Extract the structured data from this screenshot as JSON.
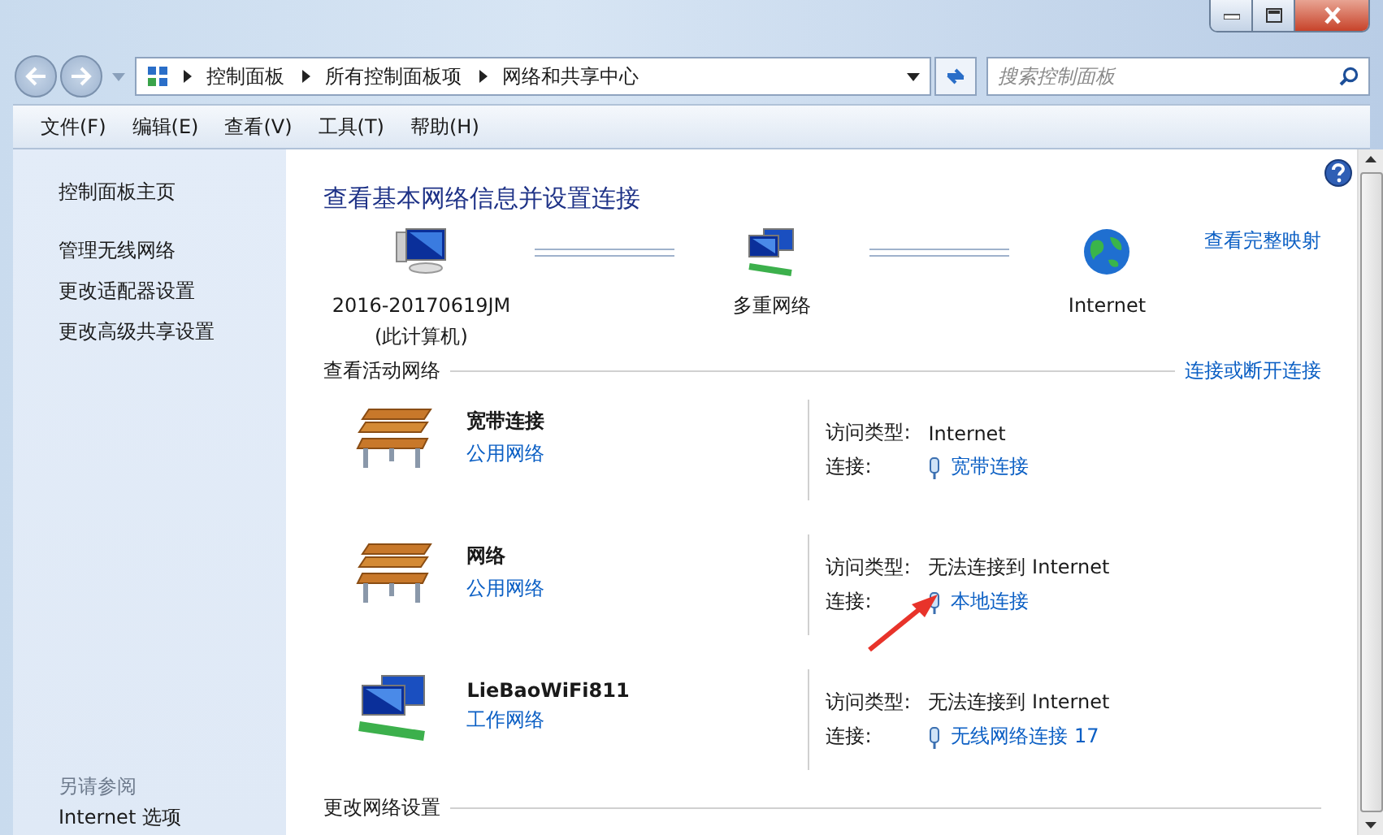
{
  "address_bar": {
    "segments": [
      "控制面板",
      "所有控制面板项",
      "网络和共享中心"
    ]
  },
  "search": {
    "placeholder": "搜索控制面板"
  },
  "menu": [
    "文件(F)",
    "编辑(E)",
    "查看(V)",
    "工具(T)",
    "帮助(H)"
  ],
  "sidebar": {
    "home": "控制面板主页",
    "items": [
      "管理无线网络",
      "更改适配器设置",
      "更改高级共享设置"
    ],
    "see_also_title": "另请参阅",
    "see_also": [
      "Internet 选项"
    ]
  },
  "main": {
    "title": "查看基本网络信息并设置连接",
    "view_full_map": "查看完整映射",
    "map_nodes": [
      {
        "kind": "computer",
        "label": "2016-20170619JM",
        "sublabel": "(此计算机)"
      },
      {
        "kind": "network",
        "label": "多重网络"
      },
      {
        "kind": "internet",
        "label": "Internet"
      }
    ],
    "active_title": "查看活动网络",
    "connect_link": "连接或断开连接",
    "networks": [
      {
        "kind": "public",
        "name": "宽带连接",
        "category": "公用网络",
        "access_label": "访问类型:",
        "access": "Internet",
        "connection_label": "连接:",
        "connection": "宽带连接"
      },
      {
        "kind": "public",
        "name": "网络",
        "category": "公用网络",
        "access_label": "访问类型:",
        "access": "无法连接到 Internet",
        "connection_label": "连接:",
        "connection": "本地连接"
      },
      {
        "kind": "work",
        "name": "LieBaoWiFi811",
        "category": "工作网络",
        "access_label": "访问类型:",
        "access": "无法连接到 Internet",
        "connection_label": "连接:",
        "connection": "无线网络连接 17"
      }
    ],
    "change_title": "更改网络设置"
  }
}
